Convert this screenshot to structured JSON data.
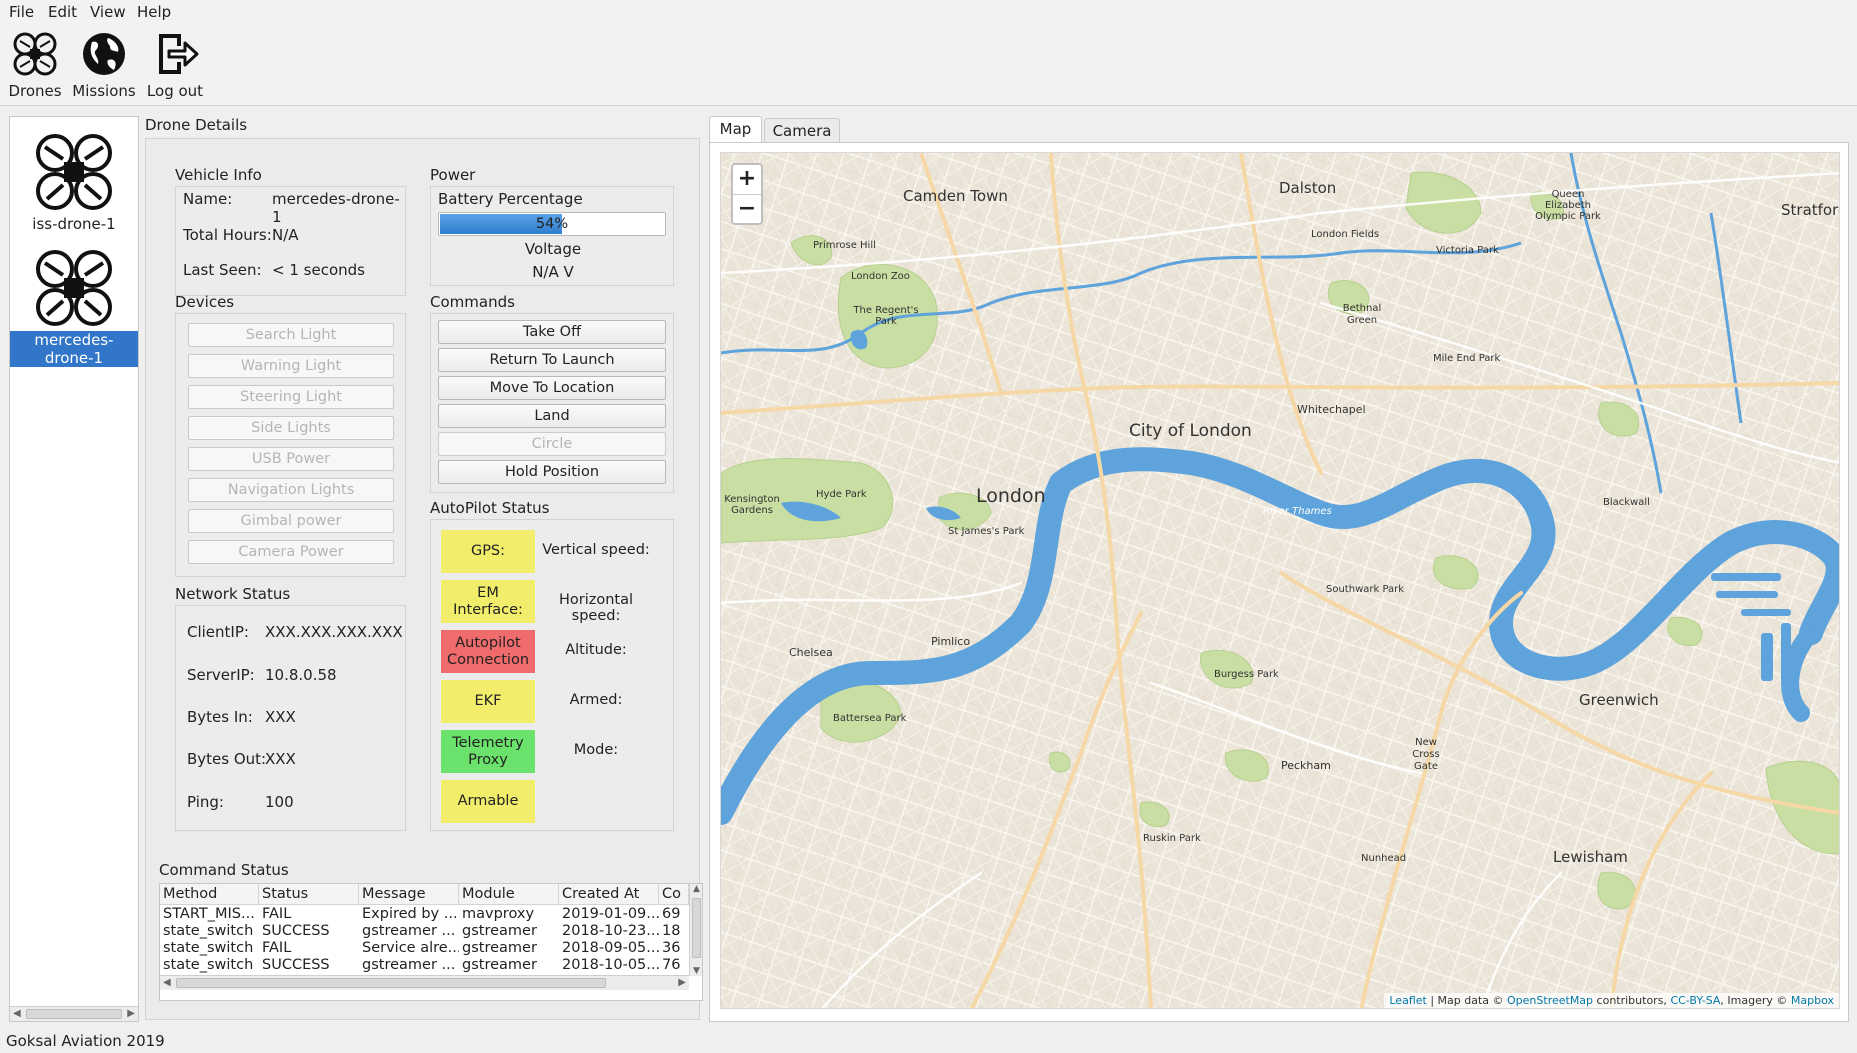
{
  "menu": {
    "items": [
      "File",
      "Edit",
      "View",
      "Help"
    ]
  },
  "toolbar": {
    "drones_label": "Drones",
    "missions_label": "Missions",
    "logout_label": "Log out"
  },
  "drone_list": {
    "items": [
      {
        "label": "iss-drone-1",
        "selected": false
      },
      {
        "label": "mercedes-drone-1",
        "selected": true
      }
    ]
  },
  "details": {
    "title": "Drone Details",
    "vehicle_info": {
      "title": "Vehicle Info",
      "name_label": "Name:",
      "name_value": "mercedes-drone-1",
      "hours_label": "Total Hours:",
      "hours_value": "N/A",
      "seen_label": "Last Seen:",
      "seen_value": "< 1 seconds"
    },
    "power": {
      "title": "Power",
      "battery_label": "Battery Percentage",
      "battery_text": "54%",
      "battery_percent": 54,
      "voltage_label": "Voltage",
      "voltage_value": "N/A V"
    },
    "devices": {
      "title": "Devices",
      "buttons": [
        "Search Light",
        "Warning Light",
        "Steering Light",
        "Side Lights",
        "USB Power",
        "Navigation Lights",
        "Gimbal power",
        "Camera Power"
      ]
    },
    "commands": {
      "title": "Commands",
      "buttons": [
        {
          "label": "Take Off",
          "enabled": true
        },
        {
          "label": "Return To Launch",
          "enabled": true
        },
        {
          "label": "Move To Location",
          "enabled": true
        },
        {
          "label": "Land",
          "enabled": true
        },
        {
          "label": "Circle",
          "enabled": false
        },
        {
          "label": "Hold Position",
          "enabled": true
        }
      ]
    },
    "network": {
      "title": "Network Status",
      "client_label": "ClientIP:",
      "client_value": "XXX.XXX.XXX.XXX",
      "server_label": "ServerIP:",
      "server_value": "10.8.0.58",
      "bytes_in_label": "Bytes In:",
      "bytes_in_value": "XXX",
      "bytes_out_label": "Bytes Out:",
      "bytes_out_value": "XXX",
      "ping_label": "Ping:",
      "ping_value": "100"
    },
    "autopilot": {
      "title": "AutoPilot Status",
      "boxes": [
        {
          "label": "GPS:",
          "color": "#f2ee6b"
        },
        {
          "label": "EM Interface:",
          "color": "#f2ee6b"
        },
        {
          "label": "Autopilot Connection",
          "color": "#f06b6b"
        },
        {
          "label": "EKF",
          "color": "#f2ee6b"
        },
        {
          "label": "Telemetry Proxy",
          "color": "#6be26b"
        },
        {
          "label": "Armable",
          "color": "#f2ee6b"
        }
      ],
      "labels": [
        "Vertical speed:",
        "Horizontal speed:",
        "Altitude:",
        "Armed:",
        "Mode:"
      ]
    },
    "command_status": {
      "title": "Command Status",
      "columns": [
        "Method",
        "Status",
        "Message",
        "Module",
        "Created At",
        "Co"
      ],
      "rows": [
        [
          "START_MIS...",
          "FAIL",
          "Expired by ...",
          "mavproxy",
          "2019-01-09...",
          "69"
        ],
        [
          "state_switch",
          "SUCCESS",
          "gstreamer ...",
          "gstreamer",
          "2018-10-23...",
          "18"
        ],
        [
          "state_switch",
          "FAIL",
          "Service alre...",
          "gstreamer",
          "2018-09-05...",
          "36"
        ],
        [
          "state_switch",
          "SUCCESS",
          "gstreamer ...",
          "gstreamer",
          "2018-10-05...",
          "76"
        ]
      ]
    }
  },
  "tabs": [
    {
      "label": "Map",
      "active": true
    },
    {
      "label": "Camera",
      "active": false
    }
  ],
  "map": {
    "zoom_in": "+",
    "zoom_out": "−",
    "labels": [
      "Camden Town",
      "Dalston",
      "Stratford",
      "Primrose Hill",
      "London Zoo",
      "The Regent's Park",
      "Queen Elizabeth Olympic Park",
      "Victoria Park",
      "London Fields",
      "Bethnal Green",
      "Mile End Park",
      "Whitechapel",
      "City of London",
      "London",
      "Hyde Park",
      "Kensington Gardens",
      "St James's Park",
      "Blackwall",
      "River Thames",
      "Southwark Park",
      "Chelsea",
      "Pimlico",
      "Battersea Park",
      "Burgess Park",
      "Greenwich",
      "New Cross Gate",
      "Peckham",
      "Lewisham",
      "Ruskin Park",
      "Nunhead"
    ],
    "attribution": {
      "leaflet": "Leaflet",
      "prefix": " | Map data © ",
      "osm": "OpenStreetMap",
      "mid": " contributors, ",
      "license": "CC-BY-SA",
      "imagery": ", Imagery © ",
      "mapbox": "Mapbox"
    }
  },
  "footer": {
    "text": "Goksal Aviation 2019"
  },
  "colors": {
    "accent": "#3176c8",
    "water": "#5ea3db",
    "park": "#c9dfa5",
    "land": "#ebe4d8"
  }
}
